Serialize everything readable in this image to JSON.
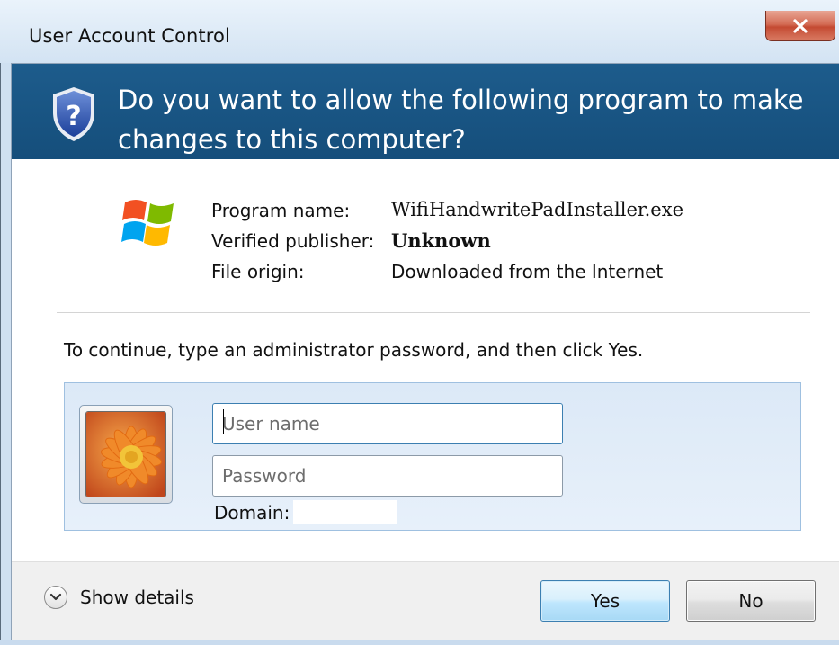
{
  "window": {
    "title": "User Account Control",
    "close_icon": "close-icon"
  },
  "header": {
    "icon": "shield-question-icon",
    "question": "Do you want to allow the following program to make changes to this computer?"
  },
  "program_info": {
    "logo_icon": "windows-logo-icon",
    "rows": [
      {
        "label": "Program name:",
        "value": "WifiHandwritePadInstaller.exe"
      },
      {
        "label": "Verified publisher:",
        "value": "Unknown"
      },
      {
        "label": "File origin:",
        "value": "Downloaded from the Internet"
      }
    ]
  },
  "instruction": "To continue, type an administrator password, and then click Yes.",
  "credentials": {
    "avatar_icon": "flower-avatar-icon",
    "username_placeholder": "User name",
    "username_value": "",
    "password_placeholder": "Password",
    "password_value": "",
    "domain_label": "Domain:",
    "domain_value": ""
  },
  "footer": {
    "details_label": "Show details",
    "details_icon": "chevron-down-icon",
    "yes_label": "Yes",
    "no_label": "No"
  },
  "colors": {
    "header_bg": "#1a5787",
    "panel_bg": "#dce9f7",
    "close_red": "#c94a32",
    "default_button_border": "#3c7fb1"
  }
}
